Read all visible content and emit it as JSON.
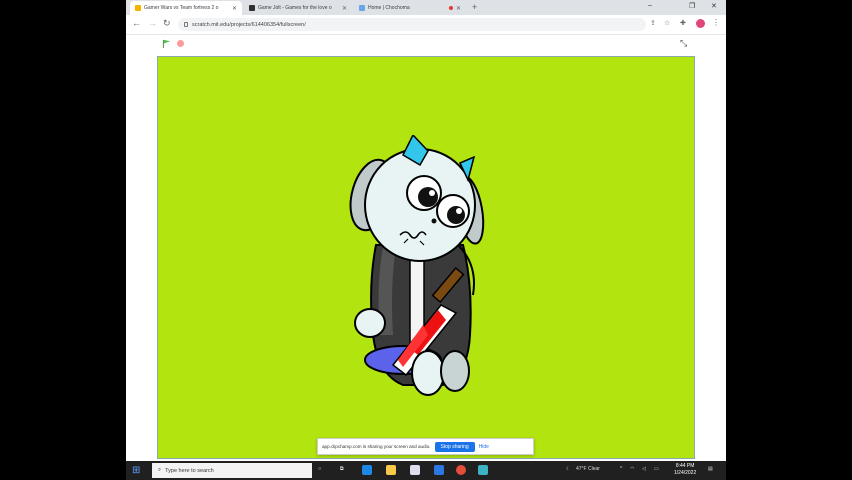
{
  "browser": {
    "tabs": [
      {
        "title": "Gamer Wars vs Team fortress 2 o",
        "active": true
      },
      {
        "title": "Game Jolt - Games for the love o",
        "active": false
      },
      {
        "title": "Home | Chochoma",
        "active": false
      }
    ],
    "url": "scratch.mit.edu/projects/614406354/fullscreen/"
  },
  "share_bar": {
    "message": "app.clipchamp.com is sharing your screen and audio.",
    "stop_label": "Stop sharing",
    "hide_label": "Hide"
  },
  "taskbar": {
    "search_placeholder": "Type here to search",
    "weather": "47°F Clear",
    "time": "8:44 PM",
    "date": "1/24/2022"
  },
  "colors": {
    "stage": "#b2e50f",
    "accent": "#1a73e8"
  },
  "icons": [
    "scratch-icon",
    "gamejolt-icon",
    "chochoma-icon",
    "green-flag-icon",
    "stop-icon",
    "exit-fullscreen-icon"
  ]
}
